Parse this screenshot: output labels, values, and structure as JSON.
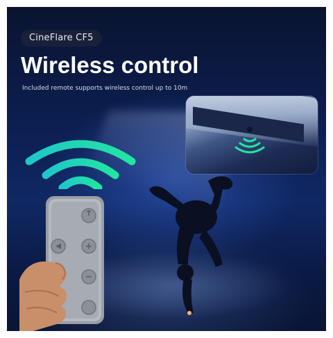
{
  "badge": {
    "text": "CineFlare CF5"
  },
  "headline": {
    "title": "Wireless control"
  },
  "subline": {
    "text": "Included remote supports wireless control up to 10m"
  },
  "colors": {
    "signal_green": "#22e6a0",
    "signal_teal": "#1fc7c7",
    "night_blue": "#0d1f52",
    "text_white": "#ffffff"
  },
  "icons": {
    "signal": "wifi-arcs-icon",
    "remote_buttons": [
      "power-icon",
      "left-icon",
      "plus-icon",
      "minus-icon",
      "circle-button-icon"
    ]
  }
}
